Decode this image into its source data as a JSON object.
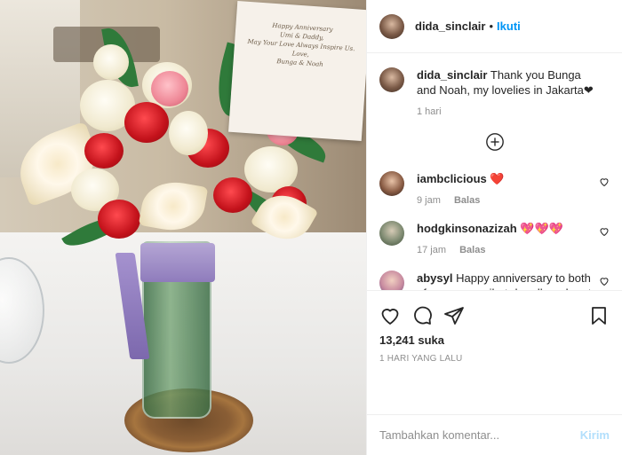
{
  "post": {
    "author": "dida_sinclair",
    "follow_label": "Ikuti",
    "separator": "•"
  },
  "card_text": [
    "Happy Anniversary",
    "Umi & Daddy,",
    "May Your Love Always Inspire Us.",
    "Love,",
    "Bunga & Noah"
  ],
  "caption": {
    "user": "dida_sinclair",
    "text": "Thank you Bunga and Noah, my lovelies in Jakarta❤",
    "time": "1 hari"
  },
  "comments": [
    {
      "user": "iambclicious",
      "text": "❤️",
      "time": "9 jam",
      "reply_label": "Balas"
    },
    {
      "user": "hodgkinsonazizah",
      "text": "💖💖💖",
      "time": "17 jam",
      "reply_label": "Balas"
    },
    {
      "user": "abysyl",
      "text": "Happy anniversary to both of u.semoga sihat dan dlm rahmat Allah swt",
      "time": "",
      "reply_label": ""
    }
  ],
  "stats": {
    "likes": "13,241 suka",
    "timestamp": "1 HARI YANG LALU"
  },
  "composer": {
    "placeholder": "Tambahkan komentar...",
    "post_label": "Kirim"
  },
  "icons": {
    "like": "heart-icon",
    "comment": "comment-icon",
    "share": "share-icon",
    "save": "bookmark-icon",
    "load_more": "plus-circle-icon"
  },
  "colors": {
    "accent": "#0095f6",
    "post_disabled": "#b2dffc",
    "heart": "#e31b5a",
    "muted": "#8e8e8e"
  }
}
